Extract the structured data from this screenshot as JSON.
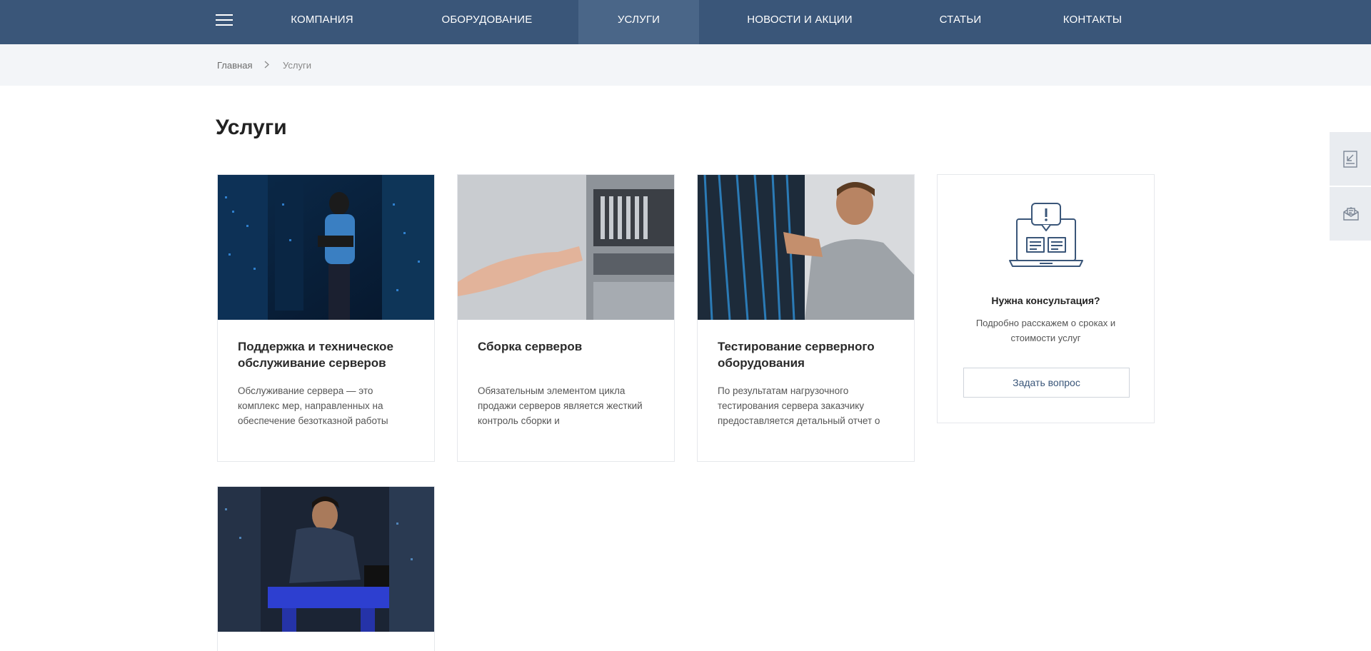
{
  "nav": {
    "items": [
      {
        "label": "Компания",
        "active": false
      },
      {
        "label": "Оборудование",
        "active": false
      },
      {
        "label": "Услуги",
        "active": true
      },
      {
        "label": "Новости и акции",
        "active": false
      },
      {
        "label": "Статьи",
        "active": false
      },
      {
        "label": "Контакты",
        "active": false
      }
    ]
  },
  "breadcrumb": {
    "home": "Главная",
    "current": "Услуги"
  },
  "page": {
    "title": "Услуги"
  },
  "services": [
    {
      "title": "Поддержка и техническое обслуживание серверов",
      "text": "Обслуживание сервера — это комплекс мер, направленных на обеспечение безотказной работы"
    },
    {
      "title": "Сборка серверов",
      "text": "Обязательным элементом цикла продажи серверов является жесткий контроль сборки и"
    },
    {
      "title": "Тестирование серверного оборудования",
      "text": "По результатам нагрузочного тестирования сервера заказчику предоставляется детальный отчет о"
    },
    {
      "title": "",
      "text": ""
    }
  ],
  "consult": {
    "title": "Нужна консультация?",
    "text": "Подробно расскажем о сроках и стоимости услуг",
    "button": "Задать вопрос"
  },
  "colors": {
    "nav_bg": "#3a5679",
    "nav_active": "#4a6688",
    "breadcrumb_bg": "#f3f5f8"
  },
  "icons": {
    "menu": "hamburger-icon",
    "breadcrumb_sep": "chevron-right-icon",
    "consult": "laptop-chat-icon",
    "side_top": "document-arrow-icon",
    "side_bottom": "envelope-icon"
  }
}
